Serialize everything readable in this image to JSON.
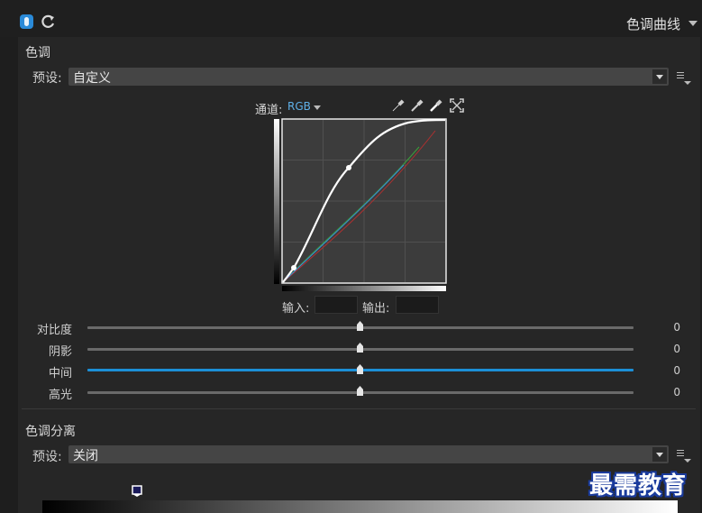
{
  "header": {
    "panel_title": "色调曲线",
    "icons": [
      "toggle-icon",
      "reset-icon",
      "panel-menu-icon"
    ]
  },
  "tone": {
    "section_title": "色调",
    "preset_label": "预设:",
    "preset_value": "自定义",
    "channel_label": "通道:",
    "channel_value": "RGB",
    "tools": [
      "eyedropper-icon",
      "eyedropper-icon",
      "eyedropper-icon",
      "expand-icon"
    ],
    "input_label": "输入:",
    "output_label": "输出:",
    "input_value": "",
    "output_value": ""
  },
  "sliders": [
    {
      "label": "对比度",
      "value": "0",
      "level": 0.5,
      "active": false
    },
    {
      "label": "阴影",
      "value": "0",
      "level": 0.5,
      "active": false
    },
    {
      "label": "中间",
      "value": "0",
      "level": 0.5,
      "active": true
    },
    {
      "label": "高光",
      "value": "0",
      "level": 0.5,
      "active": false
    }
  ],
  "split_toning": {
    "section_title": "色调分离",
    "preset_label": "预设:",
    "preset_value": "关闭"
  },
  "colors": {
    "accent": "#1c8fd6",
    "curve_white": "#ffffff",
    "curve_red": "#b03030",
    "curve_green": "#3aa03a",
    "curve_blue": "#3a8ad8",
    "panel_bg": "#262626"
  },
  "watermark": "最需教育"
}
